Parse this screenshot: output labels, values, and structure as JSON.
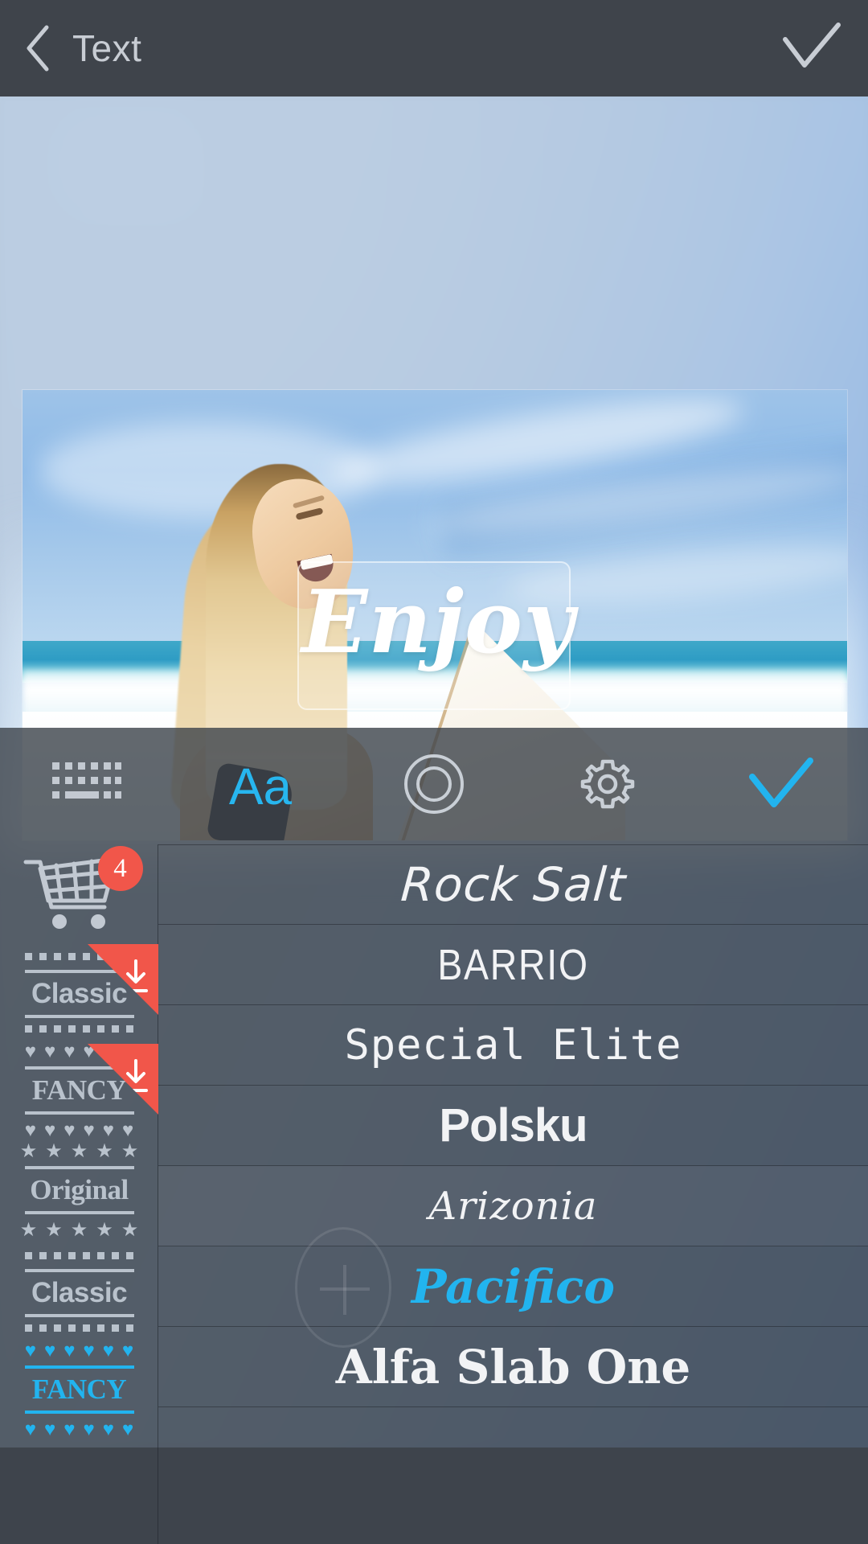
{
  "topbar": {
    "back_icon": "chevron-left-icon",
    "title": "Text",
    "confirm_icon": "check-icon"
  },
  "canvas": {
    "overlay_text": "Enjoy",
    "selection_box": "text-selection-frame"
  },
  "toolbar": {
    "items": [
      {
        "name": "keyboard",
        "icon": "keyboard-icon",
        "label": "",
        "active": false
      },
      {
        "name": "font",
        "icon": "aa-icon",
        "label": "Aa",
        "active": true
      },
      {
        "name": "color",
        "icon": "circle-ring-icon",
        "label": "",
        "active": false
      },
      {
        "name": "settings",
        "icon": "gear-icon",
        "label": "",
        "active": false
      },
      {
        "name": "apply",
        "icon": "check-icon",
        "label": "",
        "active": true
      }
    ]
  },
  "sidebar": {
    "cart": {
      "icon": "shopping-cart-icon",
      "badge": "4"
    },
    "styles": [
      {
        "word": "Classic",
        "style": "dots",
        "color": "white",
        "downloadable": true
      },
      {
        "word": "FANCY",
        "style": "hearts",
        "color": "white",
        "downloadable": true
      },
      {
        "word": "Original",
        "style": "stars",
        "color": "white",
        "downloadable": false
      },
      {
        "word": "Classic",
        "style": "dots",
        "color": "white",
        "downloadable": false
      },
      {
        "word": "FANCY",
        "style": "hearts",
        "color": "cyan",
        "downloadable": false
      }
    ]
  },
  "font_list": {
    "fonts": [
      {
        "name": "Rock Salt",
        "selected": false
      },
      {
        "name": "BARRIO",
        "selected": false
      },
      {
        "name": "Special Elite",
        "selected": false
      },
      {
        "name": "Polsku",
        "selected": false
      },
      {
        "name": "Arizonia",
        "selected": false
      },
      {
        "name": "Pacifico",
        "selected": true
      },
      {
        "name": "Alfa Slab One",
        "selected": false
      }
    ]
  },
  "colors": {
    "topbar_bg": "#3f444b",
    "panel_bg": "#3c424a",
    "accent_cyan": "#22b4ef",
    "badge_red": "#f1564a",
    "text_light": "#c8cdd4"
  }
}
